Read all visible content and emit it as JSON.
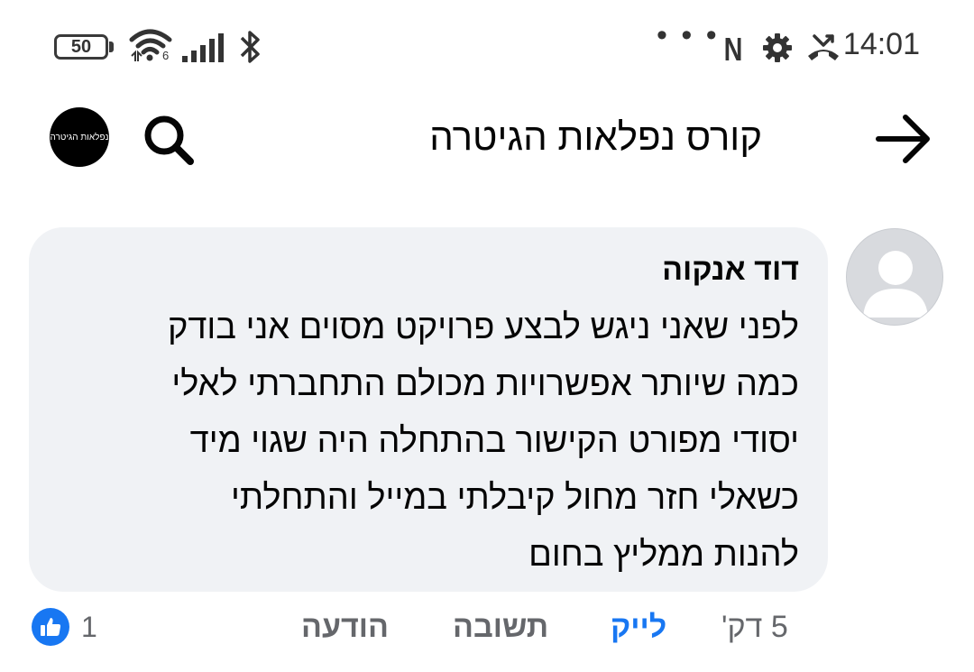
{
  "status_bar": {
    "battery": "50",
    "network_badge": "6",
    "time": "14:01",
    "overflow_dots": "• • •",
    "notification_letter": "N",
    "icons": [
      "battery-icon",
      "wifi-icon",
      "signal-icon",
      "bluetooth-icon",
      "gear-icon",
      "missed-call-icon"
    ]
  },
  "header": {
    "title": "קורס נפלאות הגיטרה",
    "back_icon": "arrow-right-icon",
    "search_icon": "search-icon",
    "logo_text": "נפלאות הגיטרה"
  },
  "comment": {
    "author": "דוד אנקוה",
    "lines": [
      "לפני שאני ניגש לבצע פרויקט מסוים אני בודק",
      "כמה שיותר אפשרויות מכולם התחברתי לאלי",
      "יסודי מפורט הקישור בהתחלה היה שגוי מיד",
      "כשאלי חזר מחול קיבלתי במייל והתחלתי",
      "להנות ממליץ בחום"
    ]
  },
  "actions": {
    "time": "5 דק'",
    "like": "לייק",
    "reply": "תשובה",
    "report": "הודעה",
    "like_count": "1"
  },
  "colors": {
    "accent": "#1877f2",
    "bubble": "#f0f2f5",
    "muted": "#65676b"
  }
}
